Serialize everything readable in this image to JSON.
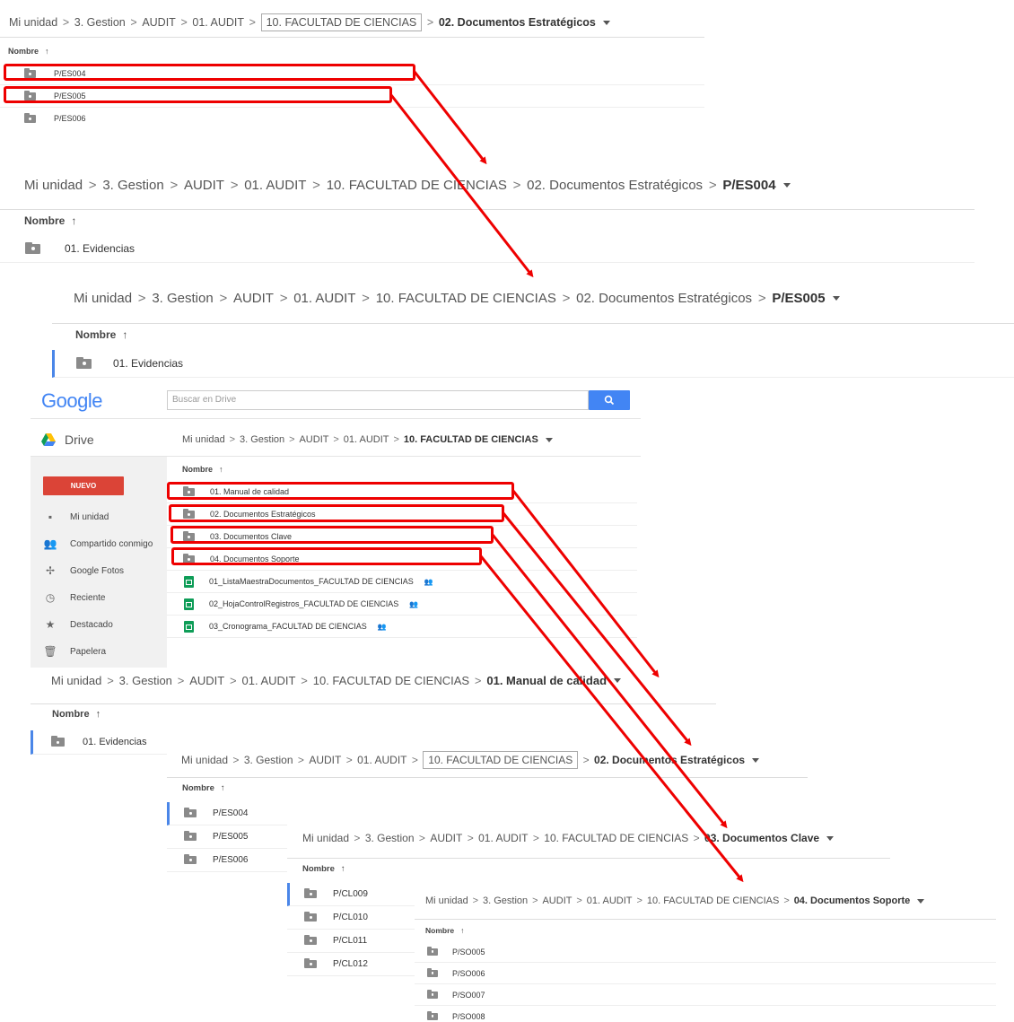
{
  "colors": {
    "highlight": "#e00000",
    "drive_blue": "#4285f4",
    "nuevo_red": "#db4437",
    "accent_selection": "#4a86e8"
  },
  "crumbs": {
    "mi_unidad": "Mi unidad",
    "gestion": "3. Gestion",
    "audit": "AUDIT",
    "audit01": "01. AUDIT",
    "facultad": "10. FACULTAD DE CIENCIAS",
    "estrategicos": "02. Documentos Estratégicos",
    "es004": "P/ES004",
    "es005": "P/ES005",
    "manual": "01. Manual de calidad",
    "clave": "03. Documentos Clave",
    "soporte": "04. Documentos Soporte",
    "separator": ">"
  },
  "column_header": "Nombre",
  "sort_arrow": "↑",
  "panels": {
    "estrategicos_top": {
      "rows": [
        "P/ES004",
        "P/ES005",
        "P/ES006"
      ]
    },
    "es004": {
      "rows": [
        "01. Evidencias"
      ]
    },
    "es005": {
      "rows": [
        "01. Evidencias"
      ]
    },
    "manual": {
      "rows": [
        "01. Evidencias"
      ]
    },
    "estrategicos_bottom": {
      "rows": [
        "P/ES004",
        "P/ES005",
        "P/ES006"
      ]
    },
    "clave": {
      "rows": [
        "P/CL009",
        "P/CL010",
        "P/CL011",
        "P/CL012"
      ]
    },
    "soporte": {
      "rows": [
        "P/SO005",
        "P/SO006",
        "P/SO007",
        "P/SO008"
      ]
    }
  },
  "drive": {
    "logo": "Google",
    "search_placeholder": "Buscar en Drive",
    "search_icon": "magnifier-icon",
    "app_name": "Drive",
    "new_button": "NUEVO",
    "nav": [
      {
        "label": "Mi unidad",
        "icon": "my-drive-icon",
        "glyph": "▪"
      },
      {
        "label": "Compartido conmigo",
        "icon": "shared-icon",
        "glyph": "👥"
      },
      {
        "label": "Google Fotos",
        "icon": "photos-icon",
        "glyph": "✢"
      },
      {
        "label": "Reciente",
        "icon": "clock-icon",
        "glyph": "◷"
      },
      {
        "label": "Destacado",
        "icon": "star-icon",
        "glyph": "★"
      },
      {
        "label": "Papelera",
        "icon": "trash-icon",
        "glyph": "🗑"
      }
    ],
    "folders": [
      "01. Manual de calidad",
      "02. Documentos Estratégicos",
      "03. Documentos Clave",
      "04. Documentos Soporte"
    ],
    "files": [
      "01_ListaMaestraDocumentos_FACULTAD DE CIENCIAS",
      "02_HojaControlRegistros_FACULTAD DE CIENCIAS",
      "03_Cronograma_FACULTAD DE CIENCIAS"
    ],
    "shared_glyph": "👥"
  }
}
